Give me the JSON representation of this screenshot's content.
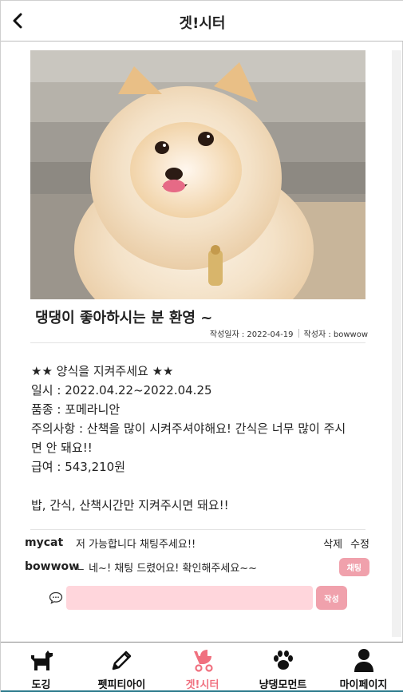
{
  "header": {
    "title": "겟!시터"
  },
  "post": {
    "title": "댕댕이 좋아하시는 분 환영 ~",
    "date_label": "작성일자 : 2022-04-19",
    "author_label": "작성자 : bowwow",
    "content_lines": [
      "★★ 양식을 지켜주세요 ★★",
      "일시 : 2022.04.22~2022.04.25",
      "품종 : 포메라니안",
      "주의사항 : 산책을 많이 시켜주셔야해요! 간식은 너무 많이 주시",
      "면 안 돼요!!",
      "급여 : 543,210원",
      "",
      "밥, 간식, 산책시간만 지켜주시면 돼요!!"
    ]
  },
  "comments": [
    {
      "user": "mycat",
      "text": "저 가능합니다 채팅주세요!!",
      "delete_label": "삭제",
      "edit_label": "수정"
    },
    {
      "user": "bowwow",
      "text": "ㄴ 네~! 채팅 드렸어요! 확인해주세요~~",
      "chat_label": "채팅"
    }
  ],
  "comment_form": {
    "value": "",
    "placeholder": "",
    "submit_label": "작성"
  },
  "nav": [
    {
      "label": "도깅",
      "icon": "dog-icon"
    },
    {
      "label": "펫피티아이",
      "icon": "pencil-icon"
    },
    {
      "label": "겟!시터",
      "icon": "stroller-icon",
      "active": true
    },
    {
      "label": "냥댕모먼트",
      "icon": "paw-icon"
    },
    {
      "label": "마이페이지",
      "icon": "person-icon"
    }
  ],
  "colors": {
    "accent": "#f0a1ac",
    "accent_light": "#ffd6dc",
    "active_nav": "#f0707f"
  }
}
